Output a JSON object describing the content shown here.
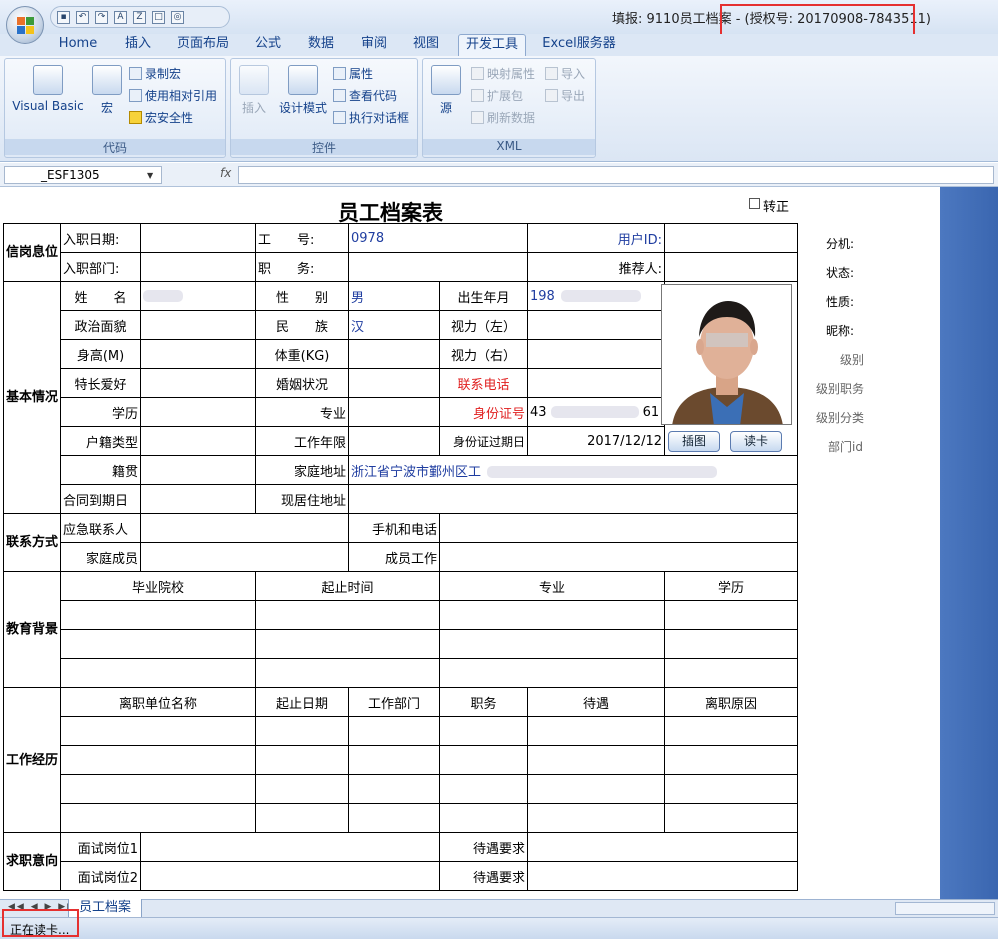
{
  "window": {
    "title": "填报: 9110员工档案 - (授权号: 20170908-7843511)"
  },
  "ribbon": {
    "tabs": [
      "Home",
      "插入",
      "页面布局",
      "公式",
      "数据",
      "审阅",
      "视图",
      "开发工具",
      "Excel服务器"
    ],
    "active_tab": "开发工具",
    "groups": {
      "code": {
        "label": "代码",
        "visual_basic": "Visual Basic",
        "macro": "宏",
        "record_macro": "录制宏",
        "relative_ref": "使用相对引用",
        "macro_security": "宏安全性"
      },
      "controls": {
        "label": "控件",
        "insert": "插入",
        "design_mode": "设计模式",
        "properties": "属性",
        "view_code": "查看代码",
        "run_dialog": "执行对话框"
      },
      "xml": {
        "label": "XML",
        "source": "源",
        "map_props": "映射属性",
        "expansion": "扩展包",
        "refresh": "刷新数据",
        "import": "导入",
        "export": "导出"
      }
    }
  },
  "formula_bar": {
    "name_box": "_ESF1305",
    "fx": "fx"
  },
  "form": {
    "title": "员工档案表",
    "checkbox_label": "转正",
    "sec_job": "信岗息位",
    "entry_date": "入职日期:",
    "emp_no_label": "工　　号:",
    "emp_no": "0978",
    "user_id_label": "用户ID:",
    "entry_dept": "入职部门:",
    "position_label": "职　　务:",
    "referrer_label": "推荐人:",
    "sec_basic": "基本情况",
    "name_label": "姓　　名",
    "gender_label": "性　　别",
    "gender": "男",
    "birth_label": "出生年月",
    "birth": "198",
    "politics_label": "政治面貌",
    "ethnic_label": "民　　族",
    "ethnic": "汉",
    "vision_left": "视力（左）",
    "height_label": "身高(M)",
    "weight_label": "体重(KG)",
    "vision_right": "视力（右）",
    "hobby_label": "特长爱好",
    "marital_label": "婚姻状况",
    "phone_label": "联系电话",
    "edu_label": "学历",
    "major_label": "专业",
    "idno_label": "身份证号",
    "idno_start": "43",
    "idno_end": "61",
    "hukou_label": "户籍类型",
    "work_years_label": "工作年限",
    "id_expiry_label": "身份证过期日",
    "id_expiry": "2017/12/12",
    "native_label": "籍贯",
    "home_addr_label": "家庭地址",
    "home_addr": "浙江省宁波市鄞州区工",
    "contract_label": "合同到期日",
    "current_addr_label": "现居住地址",
    "sec_contact": "联系方式",
    "emergency_label": "应急联系人",
    "emergency_phone_label": "手机和电话",
    "family_label": "家庭成员",
    "member_work_label": "成员工作",
    "sec_edu": "教育背景",
    "edu_headers": [
      "毕业院校",
      "起止时间",
      "专业",
      "学历"
    ],
    "sec_work": "工作经历",
    "work_headers": [
      "离职单位名称",
      "起止日期",
      "工作部门",
      "职务",
      "待遇",
      "离职原因"
    ],
    "sec_apply": "求职意向",
    "post1_label": "面试岗位1",
    "post2_label": "面试岗位2",
    "salary_req": "待遇要求",
    "photo_btn_insert": "插图",
    "photo_btn_read": "读卡"
  },
  "side_labels": [
    "分机:",
    "状态:",
    "性质:",
    "昵称:",
    "级别",
    "级别职务",
    "级别分类",
    "部门id"
  ],
  "sheet_tab": "员工档案",
  "status_text": "正在读卡..."
}
